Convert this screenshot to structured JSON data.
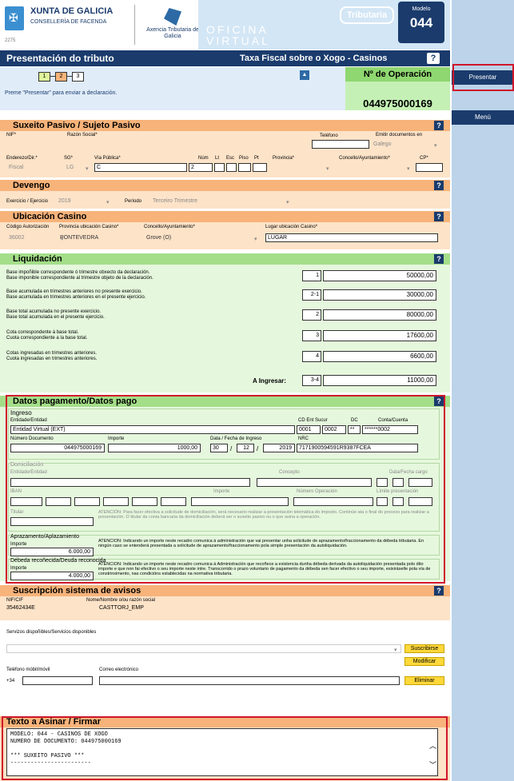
{
  "header": {
    "org_name": "XUNTA DE GALICIA",
    "org_dept": "CONSELLERÍA DE FACENDA",
    "logo_code": "2275",
    "agency": "Axencia Tributaria de Galicia",
    "oficina": "OFICINA",
    "virtual": "VIRTUAL",
    "tributaria": "Tributaria",
    "modelo_label": "Modelo",
    "modelo_value": "044"
  },
  "title_bar": {
    "title": "Presentación do tributo",
    "tax": "Taxa Fiscal sobre o Xogo - Casinos",
    "help": "?"
  },
  "steps": {
    "s1": "1",
    "s2": "2",
    "s3": "3",
    "collapse": "▲",
    "hint": "Preme \"Presentar\" para enviar a declaración."
  },
  "operacion": {
    "label": "Nº de Operación",
    "value": "044975000169"
  },
  "sujeto": {
    "title": "Suxeito Pasivo / Sujeto Pasivo",
    "nif_label": "NIF*",
    "razon_label": "Razón Social*",
    "telefono_label": "Teléfono",
    "emitir_label": "Emitir documentos en",
    "emitir_value": "Galego",
    "enderezo_label": "Enderezo/Dir.*",
    "sg_label": "SG*",
    "via_label": "Vía Pública*",
    "num_label": "Núm",
    "lt_label": "Lt",
    "esc_label": "Esc",
    "piso_label": "Piso",
    "pt_label": "Pt",
    "provincia_label": "Provincia*",
    "concello_label": "Concello/Ayuntamiento*",
    "cp_label": "CP*",
    "enderezo_value": "Fiscal",
    "sg_value": "LG",
    "via_value": "C",
    "num_value": "2"
  },
  "devengo": {
    "title": "Devengo",
    "ejercicio_label": "Exercicio / Ejercicio",
    "ejercicio_value": "2019",
    "periodo_label": "Período",
    "periodo_value": "Terceiro Trimestre"
  },
  "ubicacion": {
    "title": "Ubicación Casino",
    "codigo_label": "Código Autorización",
    "provincia_label": "Provincia ubicación Casino*",
    "concello_label": "Concello/Ayuntamiento*",
    "lugar_label": "Lugar ubicación Casino*",
    "codigo_value": "36002",
    "provincia_value": "PONTEVEDRA",
    "concello_value": "Grove (O)",
    "lugar_value": "LUGAR"
  },
  "liquidacion": {
    "title": "Liquidación",
    "rows": [
      {
        "l1": "Base impoñible correspondente ó trimestre obxecto da declaración.",
        "l2": "Base imponible correspondiente al trimestre objeto de la declaración.",
        "code": "1",
        "value": "50000,00"
      },
      {
        "l1": "Base acumulada en trimestres anteriores no presente exercicio.",
        "l2": "Base acumulada en trimestres anteriores en el presente ejercicio.",
        "code": "2-1",
        "value": "30000,00"
      },
      {
        "l1": "Base total acumulada no presente exercicio.",
        "l2": "Base total acumulada en el presente ejercicio.",
        "code": "2",
        "value": "80000,00"
      },
      {
        "l1": "Cota correspondente á base total.",
        "l2": "Cuota correspondiente a la base total.",
        "code": "3",
        "value": "17600,00"
      },
      {
        "l1": "Cotas ingresadas en trimestres anteriores.",
        "l2": "Cuota ingresadas en trimestres anteriores.",
        "code": "4",
        "value": "6600,00"
      }
    ],
    "a_ingresar_label": "A Ingresar:",
    "a_ingresar_code": "3-4",
    "a_ingresar_value": "11000,00"
  },
  "pago": {
    "title": "Datos pagamento/Datos pago",
    "ingreso_label": "Ingreso",
    "entidad_label": "Entidade/Entidad",
    "entidad_value": "Entidad Virtual (EXT)",
    "cd_label": "CD Ent Sucur",
    "dc_label": "DC",
    "cuenta_label": "Conta/Cuenta",
    "ent_value": "0001",
    "sucur_value": "0002",
    "dc_value": "**",
    "cuenta_value": "******0002",
    "numdoc_label": "Número Documento",
    "numdoc_value": "044975000169",
    "importe_label": "Importe",
    "importe_value": "1000,00",
    "fecha_label": "Data / Fecha de Ingreso",
    "dia": "30",
    "mes": "12",
    "anio": "2019",
    "nrc_label": "NRC",
    "nrc_value": "7171900594591R9387FCEA",
    "domi_label": "Domiciliación",
    "domi_entidad_label": "Entidade/Entidad",
    "concepto_label": "Concepto",
    "fecha_cargo_label": "Data/Fecha cargo",
    "iban_label": "IBAN",
    "domi_importe_label": "Importe",
    "num_oper_label": "Número Operación",
    "limite_label": "Límite presentación",
    "titular_label": "Titular",
    "domi_note": "ATENCIÓN: Para facer efectiva a solicitude de domiciliación, será necesario realizar a presentación telemática do imposto. Continúe ata o final do proceso para realizar a presentación. O titular da conta bancaria da domiciliación deberá ser o suxeito pasivo ou o que asina a operación.",
    "aplaz_label": "Aprazamento/Aplazamiento",
    "aplaz_importe_label": "Importe",
    "aplaz_value": "6.000,00",
    "aplaz_note": "ATENCION: Indicando un importe neste recadro comunica á administración que vai presentar unha solicitude de aprazamento/fraccionamento da débeda tributaria. En ningún caso se entenderá presentada a solicitude de aprazamento/fraccionamento pola simple presentación da autoliquidación.",
    "debeda_label": "Débeda recoñecida/Deuda reconocida",
    "debeda_importe_label": "Importe",
    "debeda_value": "4.000,00",
    "debeda_note": "ATENCION: Indicando un importe neste recadro comunica á Administración que recoñece a existencia dunha débeda derivada da autoliquidación presentada polo dito importe e que non fai efectivo o seu importe neste intre. Transcorrido o prazo voluntario de pagamento da débeda sen facer efectivo o seu importe, esixiráselle pola vía de constrinximento, nas condicións establecidas na normativa tributaria."
  },
  "avisos": {
    "title": "Suscripción sistema de avisos",
    "nif_label": "NIF/CIF",
    "nif_value": "35462434E",
    "nome_label": "Nome/Nombre o/ou razón social",
    "nome_value": "CASTTORJ_EMP",
    "servizos_label": "Servizos dispoñibles/Servicios disponibles",
    "suscribirse": "Suscribirse",
    "modificar": "Modificar",
    "eliminar": "Eliminar",
    "telefono_label": "Teléfono móbil/móvil",
    "prefix": "+34",
    "correo_label": "Correo electrónico"
  },
  "firmar": {
    "title": "Texto a Asinar / Firmar",
    "text": "MODELO: 044 - CASINOS DE XOGO\nNUMERO DE DOCUMENTO: 044975000169\n\n*** SUXEITO PASIVO ***\n------------------------"
  },
  "sidebar": {
    "presentar": "Presentar",
    "menu": "Menú"
  }
}
